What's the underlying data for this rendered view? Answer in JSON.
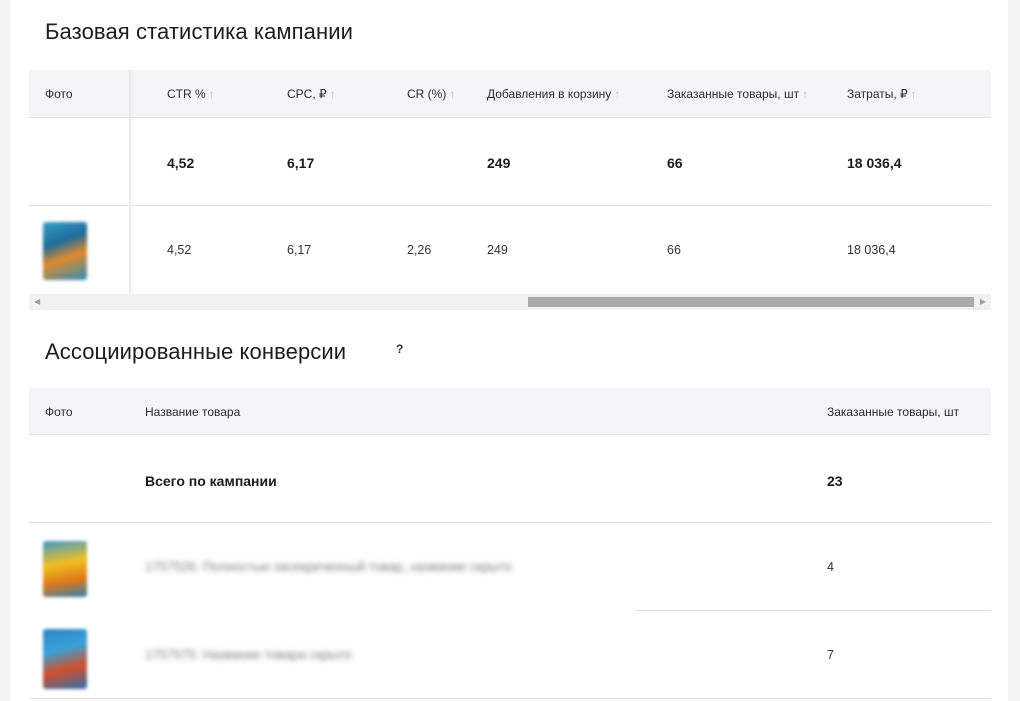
{
  "campaign_stats": {
    "title": "Базовая статистика кампании",
    "columns": [
      "Фото",
      "CTR %",
      "CPC, ₽",
      "CR (%)",
      "Добавления в корзину",
      "Заказанные товары, шт",
      "Затраты, ₽"
    ],
    "total_row": {
      "ctr": "4,52",
      "cpc": "6,17",
      "cr": "",
      "cart": "249",
      "orders": "66",
      "spend": "18 036,4"
    },
    "item_row": {
      "ctr": "4,52",
      "cpc": "6,17",
      "cr": "2,26",
      "cart": "249",
      "orders": "66",
      "spend": "18 036,4"
    },
    "sort_icon": "arrow-up-icon"
  },
  "conversions": {
    "title": "Ассоциированные конверсии",
    "help": "?",
    "columns": [
      "Фото",
      "Название товара",
      "Заказанные товары, шт"
    ],
    "total_label": "Всего по кампании",
    "total_value": "23",
    "rows": [
      {
        "name": "1757526: Полностью засекреченный товар, название скрыто",
        "qty": "4"
      },
      {
        "name": "1757575: Название товара скрыто",
        "qty": "7"
      }
    ]
  },
  "colors": {
    "header_bg": "#f5f5f7",
    "border": "#e2e2e4",
    "scroll_thumb": "#ababab"
  }
}
